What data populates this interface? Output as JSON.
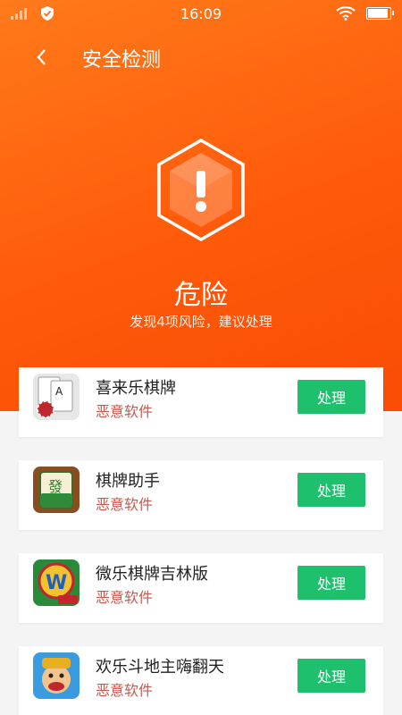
{
  "status_bar": {
    "time": "16:09"
  },
  "nav": {
    "title": "安全检测"
  },
  "result": {
    "level": "危险",
    "summary": "发现4项风险，建议处理"
  },
  "apps": [
    {
      "name": "喜来乐棋牌",
      "tag": "恶意软件",
      "action": "处理",
      "icon": "cards-icon"
    },
    {
      "name": "棋牌助手",
      "tag": "恶意软件",
      "action": "处理",
      "icon": "mahjong-icon"
    },
    {
      "name": "微乐棋牌吉林版",
      "tag": "恶意软件",
      "action": "处理",
      "icon": "weile-icon"
    },
    {
      "name": "欢乐斗地主嗨翻天",
      "tag": "恶意软件",
      "action": "处理",
      "icon": "doudizhu-icon"
    }
  ],
  "colors": {
    "header": "#ff5a0a",
    "action": "#1fc06d",
    "tag": "#c45a4f"
  }
}
